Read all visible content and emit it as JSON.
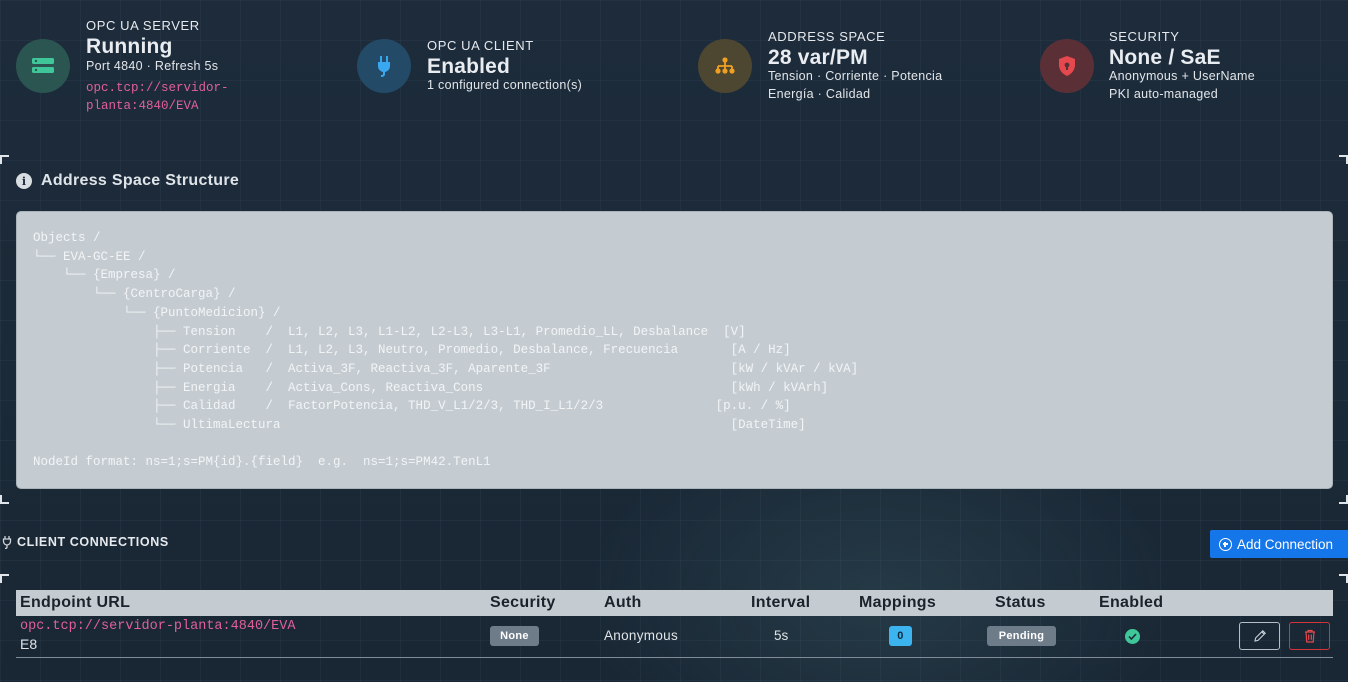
{
  "cards": {
    "server": {
      "label": "OPC UA SERVER",
      "value": "Running",
      "sub": "Port 4840 · Refresh 5s",
      "url_line1": "opc.tcp://servidor-",
      "url_line2": "planta:4840/EVA",
      "icon": "server-icon",
      "color": "#3fc79a"
    },
    "client": {
      "label": "OPC UA CLIENT",
      "value": "Enabled",
      "sub": "1 configured connection(s)",
      "icon": "plug-icon",
      "color": "#3aa8f0"
    },
    "address": {
      "label": "ADDRESS SPACE",
      "value": "28 var/PM",
      "sub1": "Tension · Corriente · Potencia",
      "sub2": "Energía · Calidad",
      "icon": "sitemap-icon",
      "color": "#f0a020"
    },
    "security": {
      "label": "SECURITY",
      "value": "None / SaE",
      "sub1": "Anonymous + UserName",
      "sub2": "PKI auto-managed",
      "icon": "shield-lock-icon",
      "color": "#e5484d"
    }
  },
  "address_space": {
    "title": "Address Space Structure",
    "tree": "Objects /\n└── EVA-GC-EE /\n    └── {Empresa} /\n        └── {CentroCarga} /\n            └── {PuntoMedicion} /\n                ├── Tension    /  L1, L2, L3, L1-L2, L2-L3, L3-L1, Promedio_LL, Desbalance  [V]\n                ├── Corriente  /  L1, L2, L3, Neutro, Promedio, Desbalance, Frecuencia       [A / Hz]\n                ├── Potencia   /  Activa_3F, Reactiva_3F, Aparente_3F                        [kW / kVAr / kVA]\n                ├── Energia    /  Activa_Cons, Reactiva_Cons                                 [kWh / kVArh]\n                ├── Calidad    /  FactorPotencia, THD_V_L1/2/3, THD_I_L1/2/3               [p.u. / %]\n                └── UltimaLectura                                                            [DateTime]\n\nNodeId format: ns=1;s=PM{id}.{field}  e.g.  ns=1;s=PM42.TenL1"
  },
  "connections": {
    "title": "CLIENT CONNECTIONS",
    "add_label": "Add Connection",
    "columns": [
      "Endpoint URL",
      "Security",
      "Auth",
      "Interval",
      "Mappings",
      "Status",
      "Enabled"
    ],
    "rows": [
      {
        "url": "opc.tcp://servidor-planta:4840/EVA",
        "name": "E8",
        "security": "None",
        "auth": "Anonymous",
        "interval": "5s",
        "mappings": "0",
        "status": "Pending",
        "enabled": true
      }
    ]
  }
}
